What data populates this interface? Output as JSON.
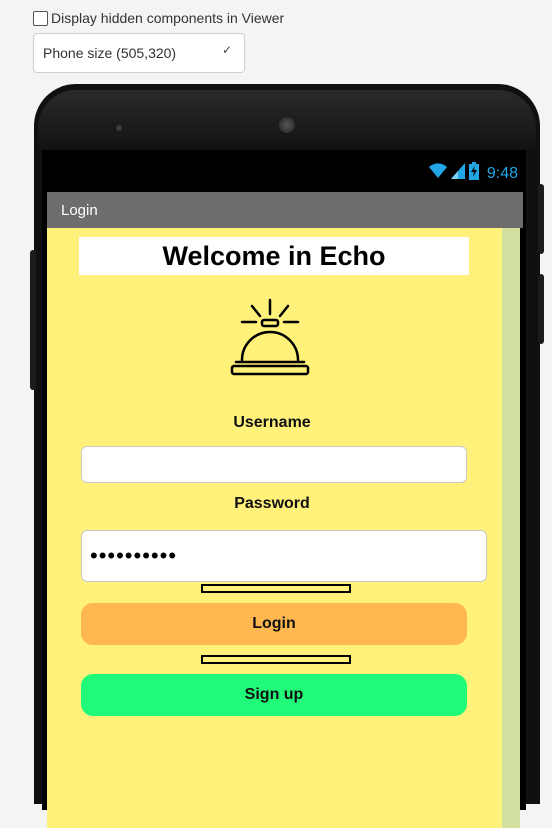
{
  "viewer": {
    "hidden_label": "Display hidden components in Viewer",
    "hidden_checked": false,
    "size_selected": "Phone size (505,320)"
  },
  "status_bar": {
    "time": "9:48",
    "icons": [
      "wifi-icon",
      "signal-icon",
      "battery-charging-icon"
    ],
    "icon_color": "#23a6e6"
  },
  "app": {
    "title": "Login",
    "welcome": "Welcome in Echo",
    "bell_icon": "service-bell-icon",
    "username_label": "Username",
    "username_value": "",
    "password_label": "Password",
    "password_value": "••••••••••",
    "login_label": "Login",
    "signup_label": "Sign up"
  },
  "colors": {
    "background": "#fff17a",
    "login_button": "#ffb74f",
    "signup_button": "#21fa79",
    "title_bar": "#6d6d6d"
  }
}
